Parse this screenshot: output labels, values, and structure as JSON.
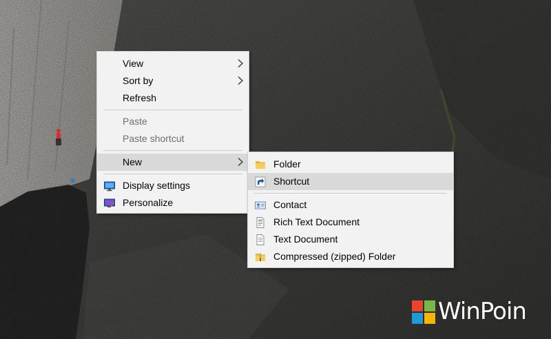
{
  "context_menu": {
    "items": [
      {
        "label": "View",
        "has_submenu": true
      },
      {
        "label": "Sort by",
        "has_submenu": true
      },
      {
        "label": "Refresh"
      },
      {
        "label": "Paste",
        "disabled": true
      },
      {
        "label": "Paste shortcut",
        "disabled": true
      },
      {
        "label": "New",
        "has_submenu": true,
        "highlighted": true
      },
      {
        "label": "Display settings",
        "icon": "display-settings-icon"
      },
      {
        "label": "Personalize",
        "icon": "personalize-icon"
      }
    ]
  },
  "new_submenu": {
    "items": [
      {
        "label": "Folder",
        "icon": "folder-icon"
      },
      {
        "label": "Shortcut",
        "icon": "shortcut-icon",
        "highlighted": true
      },
      {
        "label": "Contact",
        "icon": "contact-icon"
      },
      {
        "label": "Rich Text Document",
        "icon": "rich-text-document-icon"
      },
      {
        "label": "Text Document",
        "icon": "text-document-icon"
      },
      {
        "label": "Compressed (zipped) Folder",
        "icon": "zipped-folder-icon"
      }
    ]
  },
  "watermark": {
    "text": "WinPoin",
    "colors": [
      "#e8452c",
      "#7ab648",
      "#1e9ad6",
      "#f7b500"
    ]
  },
  "colors": {
    "menu_bg": "#f2f2f2",
    "highlight": "#d9d9d9",
    "disabled_text": "#6d6d6d"
  }
}
